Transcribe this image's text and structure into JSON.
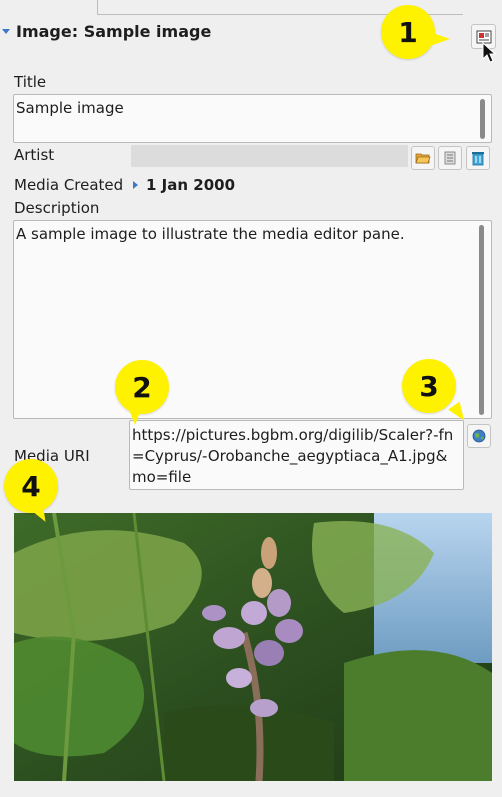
{
  "section": {
    "title": "Image: Sample image"
  },
  "fields": {
    "title_label": "Title",
    "title_value": "Sample image",
    "artist_label": "Artist",
    "artist_value": "",
    "media_created_label": "Media Created",
    "media_created_value": "1 Jan 2000",
    "description_label": "Description",
    "description_value": "A sample image to illustrate the media editor pane.",
    "media_uri_label": "Media URI",
    "media_uri_value": "https://pictures.bgbm.org/digilib/Scaler?-fn=Cyprus/-Orobanche_aegyptiaca_A1.jpg&mo=file"
  },
  "callouts": {
    "one": "1",
    "two": "2",
    "three": "3",
    "four": "4"
  },
  "colors": {
    "callout": "#fff200",
    "background": "#efefef"
  }
}
